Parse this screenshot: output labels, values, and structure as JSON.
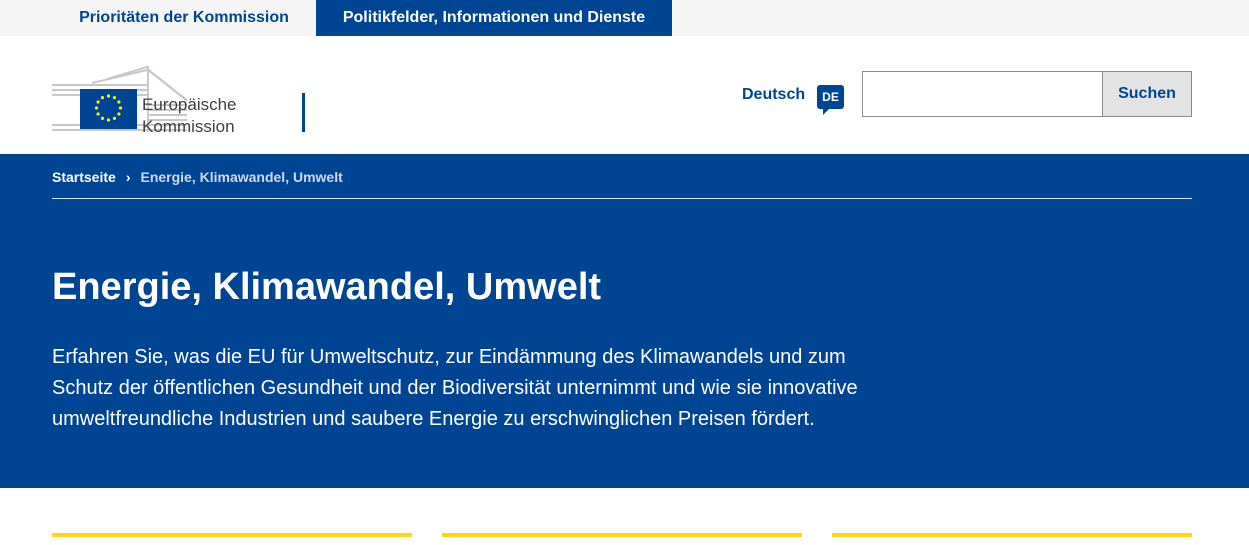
{
  "top_nav": {
    "tabs": [
      {
        "label": "Prioritäten der Kommission"
      },
      {
        "label": "Politikfelder, Informationen und Dienste"
      }
    ]
  },
  "header": {
    "logo_line1": "Europäische",
    "logo_line2": "Kommission",
    "language_label": "Deutsch",
    "language_code": "DE",
    "search": {
      "value": "",
      "placeholder": "",
      "button_label": "Suchen"
    }
  },
  "breadcrumb": {
    "home": "Startseite",
    "separator": "›",
    "current": "Energie, Klimawandel, Umwelt"
  },
  "hero": {
    "title": "Energie, Klimawandel, Umwelt",
    "description": "Erfahren Sie, was die EU für Umweltschutz, zur Eindämmung des Klimawandels und zum Schutz der öffentlichen Gesundheit und der Biodiversität unternimmt und wie sie innovative umweltfreundliche Industrien und saubere Energie zu erschwinglichen Preisen fördert."
  },
  "colors": {
    "brand_blue": "#004494",
    "accent_yellow": "#ffd617",
    "eu_star_yellow": "#ffed00"
  },
  "icons": {
    "eu_flag": "eu-flag-icon",
    "breadcrumb_separator": "chevron-right-icon"
  }
}
